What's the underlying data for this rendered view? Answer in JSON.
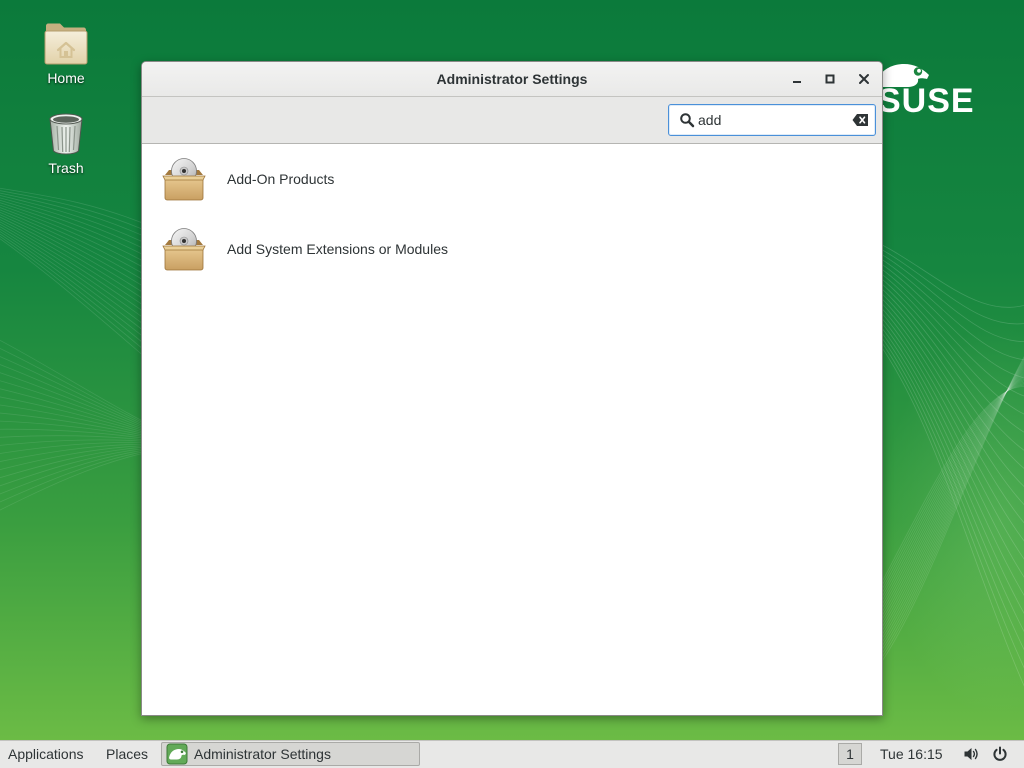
{
  "desktop": {
    "icons": [
      {
        "label": "Home",
        "icon": "home-folder-icon"
      },
      {
        "label": "Trash",
        "icon": "trash-icon"
      }
    ],
    "logo": {
      "text": "SUSE",
      "icon": "suse-chameleon-logo"
    }
  },
  "window": {
    "title": "Administrator Settings",
    "controls": {
      "minimize": "minimize-icon",
      "maximize": "maximize-icon",
      "close": "close-icon"
    },
    "search": {
      "value": "add",
      "icon": "search-icon",
      "clear_icon": "clear-text-icon"
    },
    "results": [
      {
        "label": "Add-On Products",
        "icon": "package-cd-icon"
      },
      {
        "label": "Add System Extensions or Modules",
        "icon": "package-cd-icon"
      }
    ]
  },
  "panel": {
    "applications": "Applications",
    "places": "Places",
    "tasks": [
      {
        "label": "Administrator Settings",
        "icon": "yast-icon",
        "active": true
      }
    ],
    "workspace": "1",
    "clock": "Tue 16:15",
    "status_icons": [
      "volume-icon",
      "power-icon"
    ]
  },
  "colors": {
    "accent": "#4a90d9",
    "desktop_top": "#0b7a3b",
    "desktop_bottom": "#72bf46",
    "panel_background": "#e8e8e7",
    "window_background": "#ffffff"
  }
}
